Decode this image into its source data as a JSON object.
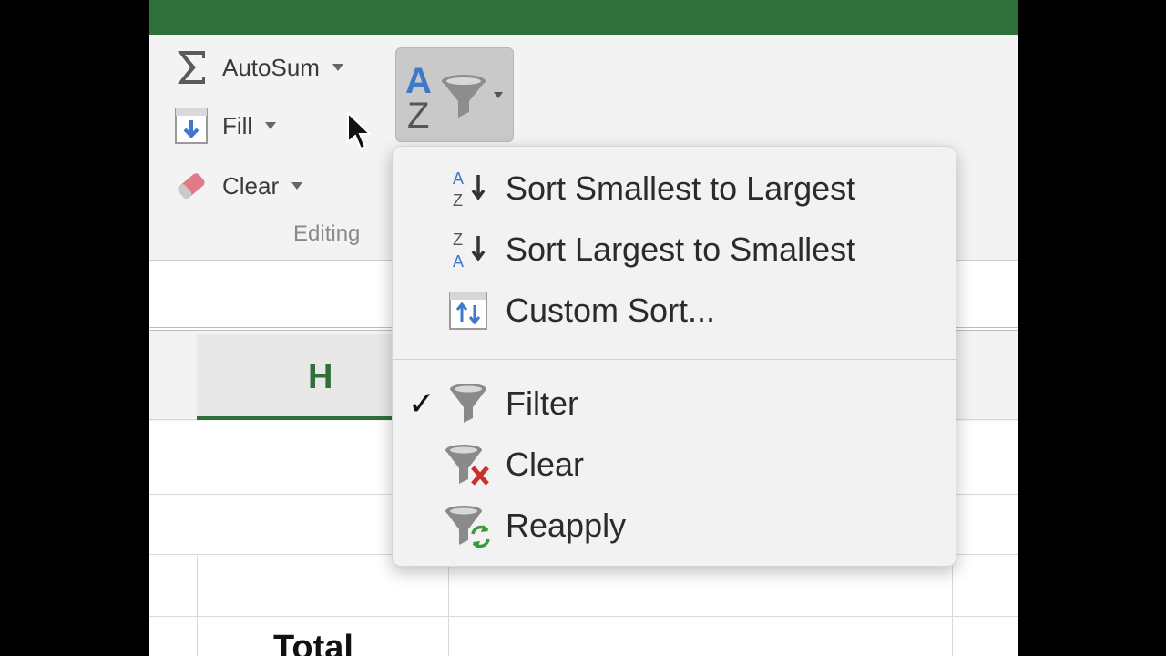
{
  "ribbon": {
    "autosum_label": "AutoSum",
    "fill_label": "Fill",
    "clear_label": "Clear",
    "group_label": "Editing"
  },
  "sheet": {
    "column_header": "H",
    "total_label": "Total"
  },
  "menu": {
    "items": [
      {
        "label": "Sort Smallest to Largest",
        "icon": "sort-ascending-icon"
      },
      {
        "label": "Sort Largest to Smallest",
        "icon": "sort-descending-icon"
      },
      {
        "label": "Custom Sort...",
        "icon": "custom-sort-icon"
      },
      {
        "label": "Filter",
        "icon": "filter-icon",
        "checked": true
      },
      {
        "label": "Clear",
        "icon": "clear-filter-icon"
      },
      {
        "label": "Reapply",
        "icon": "reapply-filter-icon"
      }
    ],
    "check_glyph": "✓"
  },
  "colors": {
    "accent_green": "#2f6f3a",
    "sort_blue": "#3d78c9",
    "clear_red": "#c8312b",
    "reapply_green": "#3a9a3a"
  }
}
